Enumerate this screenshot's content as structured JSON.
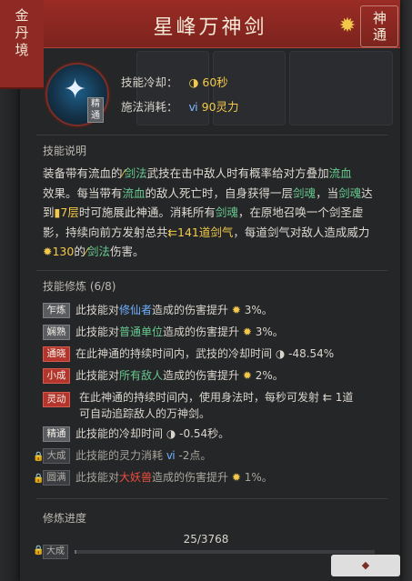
{
  "side_tab": {
    "label": "金丹境"
  },
  "header": {
    "title": "星峰万神剑",
    "seal_text": "神通"
  },
  "skill": {
    "icon_tag": "精通",
    "cooldown_label": "技能冷却：",
    "cooldown_value": "60秒",
    "cost_label": "施法消耗：",
    "cost_value": "90灵力"
  },
  "description": {
    "title": "技能说明",
    "line1": "装备带有流血的",
    "line1_a": "剑法",
    "line1_b": "武技在击中敌人时有概率给对方叠加",
    "line1_c": "流血",
    "line2": "效果。每当带有",
    "line2_a": "流血",
    "line2_b": "的敌人死亡时，自身获得一层",
    "line2_c": "剑魂",
    "line2_d": "，当",
    "line2_e": "剑魂",
    "line2_f": "达",
    "line3": "到",
    "line3_a": "7层",
    "line3_b": "时可施展此神通。消耗所有",
    "line3_c": "剑魂",
    "line3_d": "，在原地召唤一个剑圣虚",
    "line4": "影，持续向前方发射总共",
    "line4_a": "141道剑气",
    "line4_b": "，每道剑气对敌人造成威力",
    "line5_a": "130",
    "line5_b": "的",
    "line5_c": "剑法",
    "line5_d": "伤害。"
  },
  "practice": {
    "title": "技能修炼 (6/8)",
    "rows": [
      {
        "tag": "乍炼",
        "pre": "此技能对",
        "hl": "修仙者",
        "post": "造成的伤害提升",
        "val": "3%。"
      },
      {
        "tag": "娴熟",
        "pre": "此技能对",
        "hl": "普通单位",
        "post": "造成的伤害提升",
        "val": "3%。"
      },
      {
        "tag": "通晓",
        "pre": "在此神通的持续时间内，武技的冷却时间",
        "hl": "",
        "post": "",
        "val": "-48.54%"
      },
      {
        "tag": "小成",
        "pre": "此技能对",
        "hl": "所有敌人",
        "post": "造成的伤害提升",
        "val": "2%。"
      },
      {
        "tag": "灵动",
        "pre": "在此神通的持续时间内，使用身法时，每秒可发射",
        "hl": "1道",
        "post": "可自动追踪敌人的万神剑。",
        "val": ""
      },
      {
        "tag": "精通",
        "pre": "此技能的冷却时间",
        "hl": "",
        "post": "",
        "val": "-0.54秒。"
      },
      {
        "tag": "大成",
        "pre": "此技能的灵力消耗",
        "hl": "",
        "post": "",
        "val": "-2点。"
      },
      {
        "tag": "圆满",
        "pre": "此技能对",
        "hl": "大妖兽",
        "post": "造成的伤害提升",
        "val": "1%。"
      }
    ]
  },
  "progress": {
    "title": "修炼进度",
    "text": "25/3768",
    "tag": "大成",
    "fraction": 0.0066
  }
}
